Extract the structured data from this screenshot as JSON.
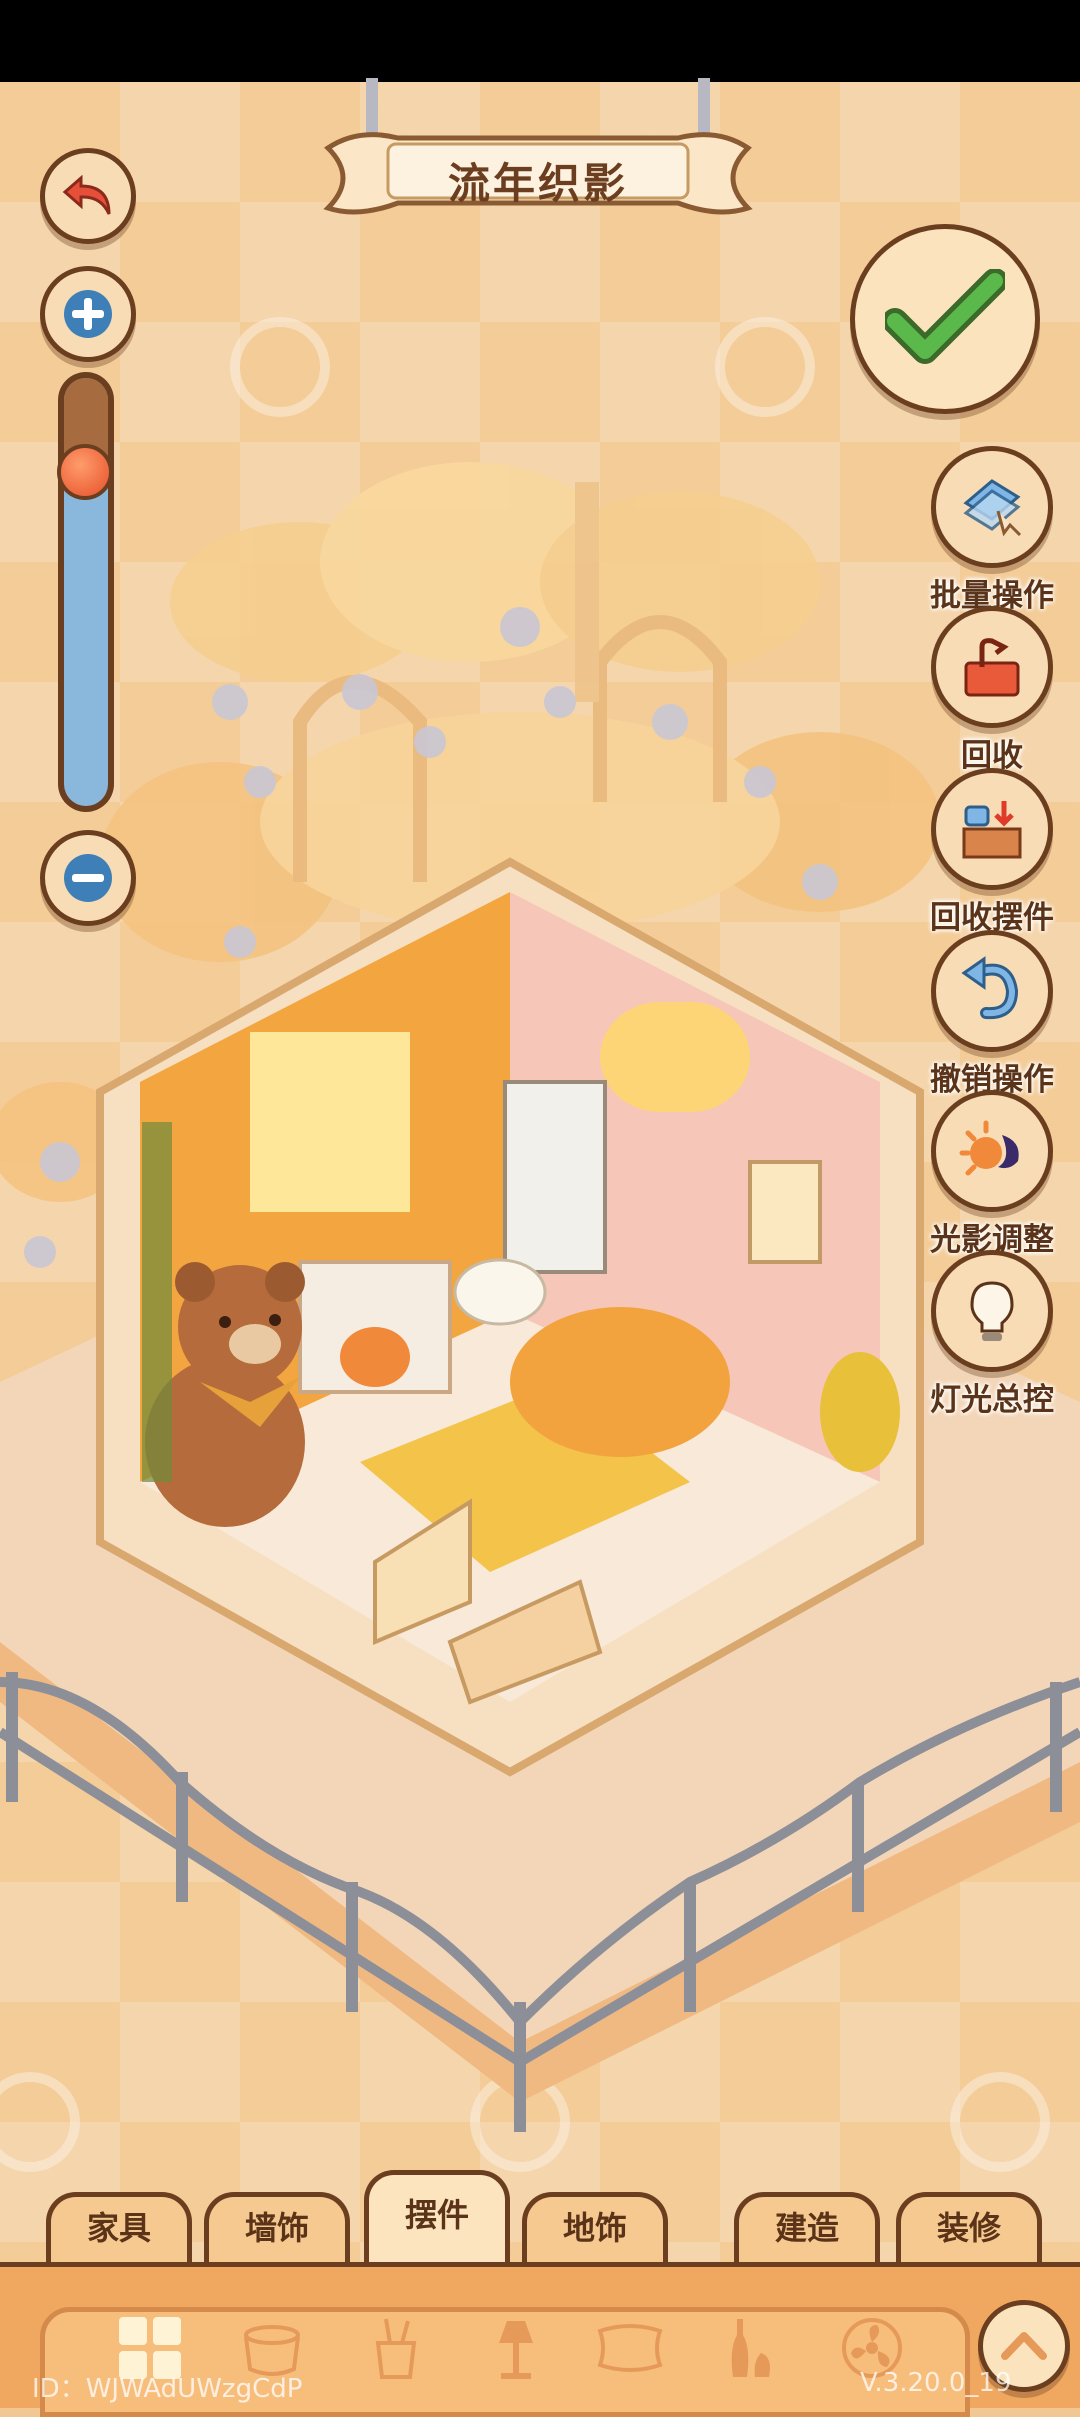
{
  "title": "流年织影",
  "tools": [
    {
      "label": "批量操作",
      "icon": "batch-select-icon"
    },
    {
      "label": "回收",
      "icon": "recycle-icon"
    },
    {
      "label": "回收摆件",
      "icon": "recycle-ornaments-icon"
    },
    {
      "label": "撤销操作",
      "icon": "undo-icon"
    },
    {
      "label": "光影调整",
      "icon": "light-shadow-icon"
    },
    {
      "label": "灯光总控",
      "icon": "lightbulb-icon"
    }
  ],
  "zoom": {
    "level": 0.78
  },
  "tabs": [
    {
      "label": "家具"
    },
    {
      "label": "墙饰"
    },
    {
      "label": "摆件",
      "active": true
    },
    {
      "label": "地饰"
    },
    {
      "label": "建造"
    },
    {
      "label": "装修"
    }
  ],
  "categories": [
    "grid-all-icon",
    "pot-icon",
    "brush-cup-icon",
    "lamp-icon",
    "pillow-icon",
    "vase-icon",
    "fan-icon"
  ],
  "footer": {
    "id_text": "ID：WJWAdUWzgCdP",
    "version": "V.3.20.0_19"
  },
  "colors": {
    "outline": "#6b3e1f",
    "confirm_green": "#5bb84a",
    "slider_blue": "#8ab8dc",
    "accent_red": "#e6502a"
  }
}
